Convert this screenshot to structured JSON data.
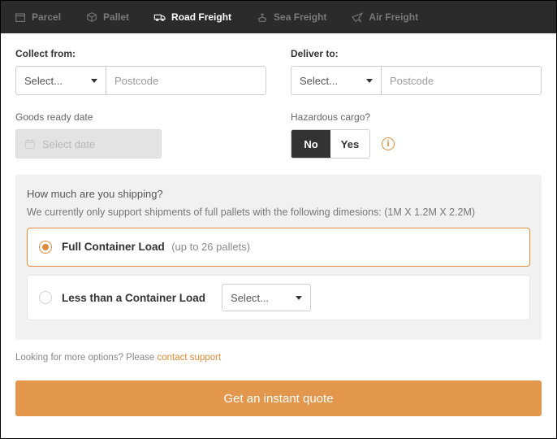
{
  "tabs": {
    "parcel": "Parcel",
    "pallet": "Pallet",
    "road": "Road Freight",
    "sea": "Sea Freight",
    "air": "Air Freight"
  },
  "form": {
    "collect_label": "Collect from:",
    "deliver_label": "Deliver to:",
    "select_placeholder": "Select...",
    "postcode_placeholder": "Postcode",
    "goods_date_label": "Goods ready date",
    "date_placeholder": "Select date",
    "hazard_label": "Hazardous cargo?",
    "hazard_no": "No",
    "hazard_yes": "Yes"
  },
  "shipping": {
    "question": "How much are you shipping?",
    "note": "We currently only support shipments of full pallets with the following dimesions: (1M X 1.2M X 2.2M)",
    "fcl_label": "Full Container Load",
    "fcl_sub": "(up to 26 pallets)",
    "lcl_label": "Less than a Container Load",
    "lcl_select": "Select..."
  },
  "footer": {
    "text": "Looking for more options? Please ",
    "link": "contact support"
  },
  "cta": "Get an instant quote"
}
